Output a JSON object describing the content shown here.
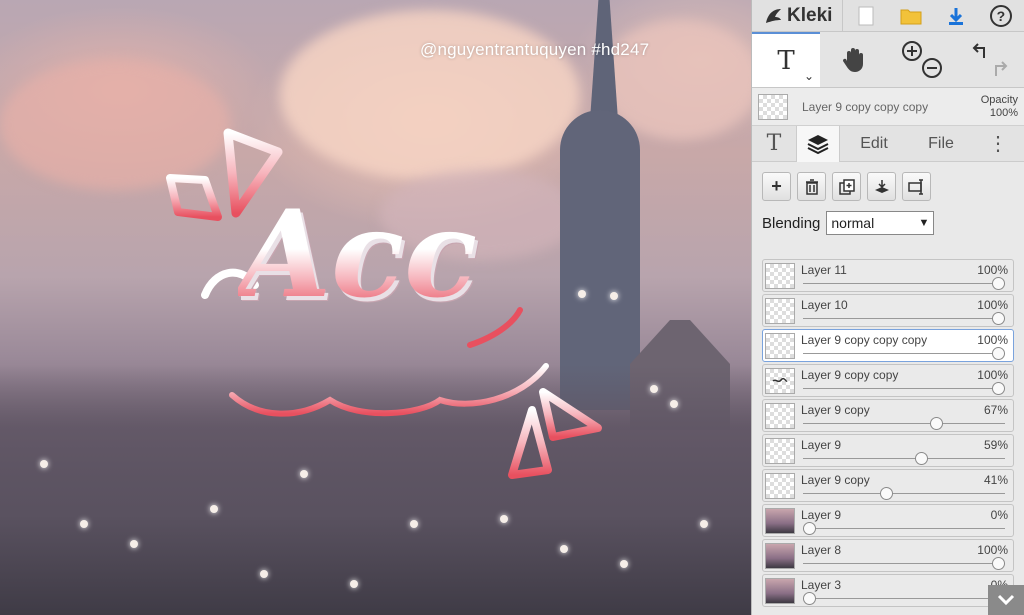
{
  "canvas": {
    "watermark": "@nguyentrantuquyen  #hd247",
    "text_art": "Acc"
  },
  "topbar": {
    "app_name": "Kleki",
    "new_icon": "new-document-icon",
    "open_icon": "folder-icon",
    "save_icon": "download-icon",
    "help_label": "?"
  },
  "tools": {
    "text_label": "T",
    "text_chevron": "⌄",
    "hand_icon": "hand-icon",
    "zoom_in_icon": "zoom-in-icon",
    "zoom_out_icon": "zoom-out-icon",
    "undo_icon": "undo-icon",
    "redo_icon": "redo-icon"
  },
  "current_layer": {
    "name": "Layer 9 copy copy copy",
    "opacity_label": "Opacity",
    "opacity_value": "100%"
  },
  "tabs": [
    {
      "label": "T",
      "icon": "text-tab-icon"
    },
    {
      "label": "",
      "icon": "layers-icon"
    },
    {
      "label": "Edit"
    },
    {
      "label": "File"
    },
    {
      "label": "⋮"
    }
  ],
  "blending": {
    "label": "Blending",
    "value": "normal"
  },
  "layers": [
    {
      "name": "Layer 11",
      "opacity": "100%",
      "level": 1.0,
      "thumb": "empty"
    },
    {
      "name": "Layer 10",
      "opacity": "100%",
      "level": 1.0,
      "thumb": "empty"
    },
    {
      "name": "Layer 9 copy copy copy",
      "opacity": "100%",
      "level": 1.0,
      "thumb": "empty",
      "selected": true
    },
    {
      "name": "Layer 9 copy copy",
      "opacity": "100%",
      "level": 1.0,
      "thumb": "scribble"
    },
    {
      "name": "Layer 9 copy",
      "opacity": "67%",
      "level": 0.67,
      "thumb": "empty"
    },
    {
      "name": "Layer 9",
      "opacity": "59%",
      "level": 0.59,
      "thumb": "empty"
    },
    {
      "name": "Layer 9 copy",
      "opacity": "41%",
      "level": 0.41,
      "thumb": "empty"
    },
    {
      "name": "Layer 9",
      "opacity": "0%",
      "level": 0.0,
      "thumb": "image"
    },
    {
      "name": "Layer 8",
      "opacity": "100%",
      "level": 1.0,
      "thumb": "image"
    },
    {
      "name": "Layer 3",
      "opacity": "0%",
      "level": 0.0,
      "thumb": "image"
    }
  ],
  "colors": {
    "accent": "#5b8fd6",
    "pink": "#e7505f"
  }
}
